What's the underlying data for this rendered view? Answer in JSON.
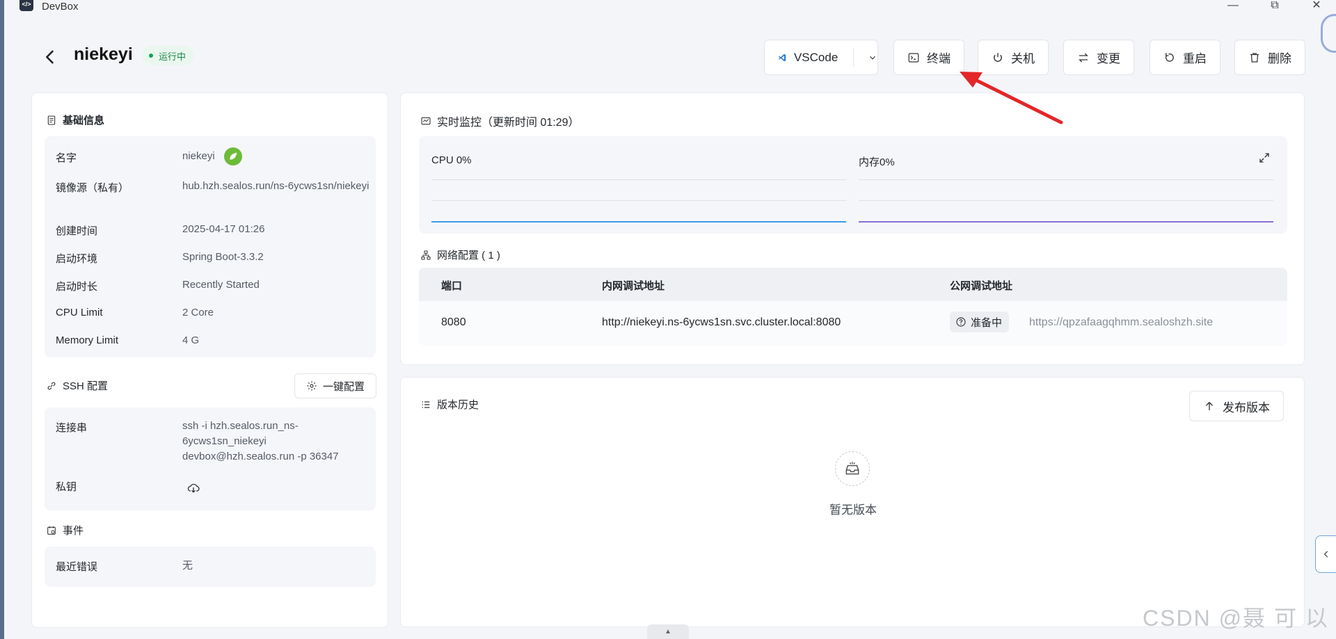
{
  "app": {
    "title": "DevBox",
    "icon": "devbox-app-icon"
  },
  "window_controls": {
    "minimize": "—",
    "restore": "⧉",
    "close": "✕"
  },
  "header": {
    "title": "niekeyi",
    "status": "运行中",
    "buttons": {
      "vscode": "VSCode",
      "terminal": "终端",
      "shutdown": "关机",
      "change": "变更",
      "restart": "重启",
      "delete": "删除"
    }
  },
  "basic_info": {
    "title": "基础信息",
    "rows": [
      {
        "label": "名字",
        "value": "niekeyi"
      },
      {
        "label": "镜像源（私有）",
        "value": "hub.hzh.sealos.run/ns-6ycws1sn/niekeyi"
      },
      {
        "label": "创建时间",
        "value": "2025-04-17 01:26"
      },
      {
        "label": "启动环境",
        "value": "Spring Boot-3.3.2"
      },
      {
        "label": "启动时长",
        "value": "Recently Started"
      },
      {
        "label": "CPU Limit",
        "value": "2 Core"
      },
      {
        "label": "Memory Limit",
        "value": "4 G"
      }
    ]
  },
  "ssh": {
    "title": "SSH 配置",
    "oneclick": "一键配置",
    "conn_label": "连接串",
    "conn_value": "ssh -i hzh.sealos.run_ns-6ycws1sn_niekeyi devbox@hzh.sealos.run -p 36347",
    "key_label": "私钥"
  },
  "events": {
    "title": "事件",
    "recent_error_label": "最近错误",
    "recent_error_value": "无"
  },
  "monitor": {
    "title": "实时监控（更新时间  01:29）",
    "cpu_label": "CPU 0%",
    "mem_label": "内存0%",
    "colors": {
      "cpu": "#3b9ae8",
      "mem": "#8a6fd6"
    }
  },
  "network": {
    "title": "网络配置 ( 1 )",
    "headers": {
      "port": "端口",
      "internal": "内网调试地址",
      "public": "公网调试地址"
    },
    "row": {
      "port": "8080",
      "internal": "http://niekeyi.ns-6ycws1sn.svc.cluster.local:8080",
      "status": "准备中",
      "public": "https://qpzafaagqhmm.sealoshzh.site"
    }
  },
  "versions": {
    "title": "版本历史",
    "publish": "发布版本",
    "empty": "暂无版本"
  },
  "watermark": "CSDN @聂 可 以"
}
